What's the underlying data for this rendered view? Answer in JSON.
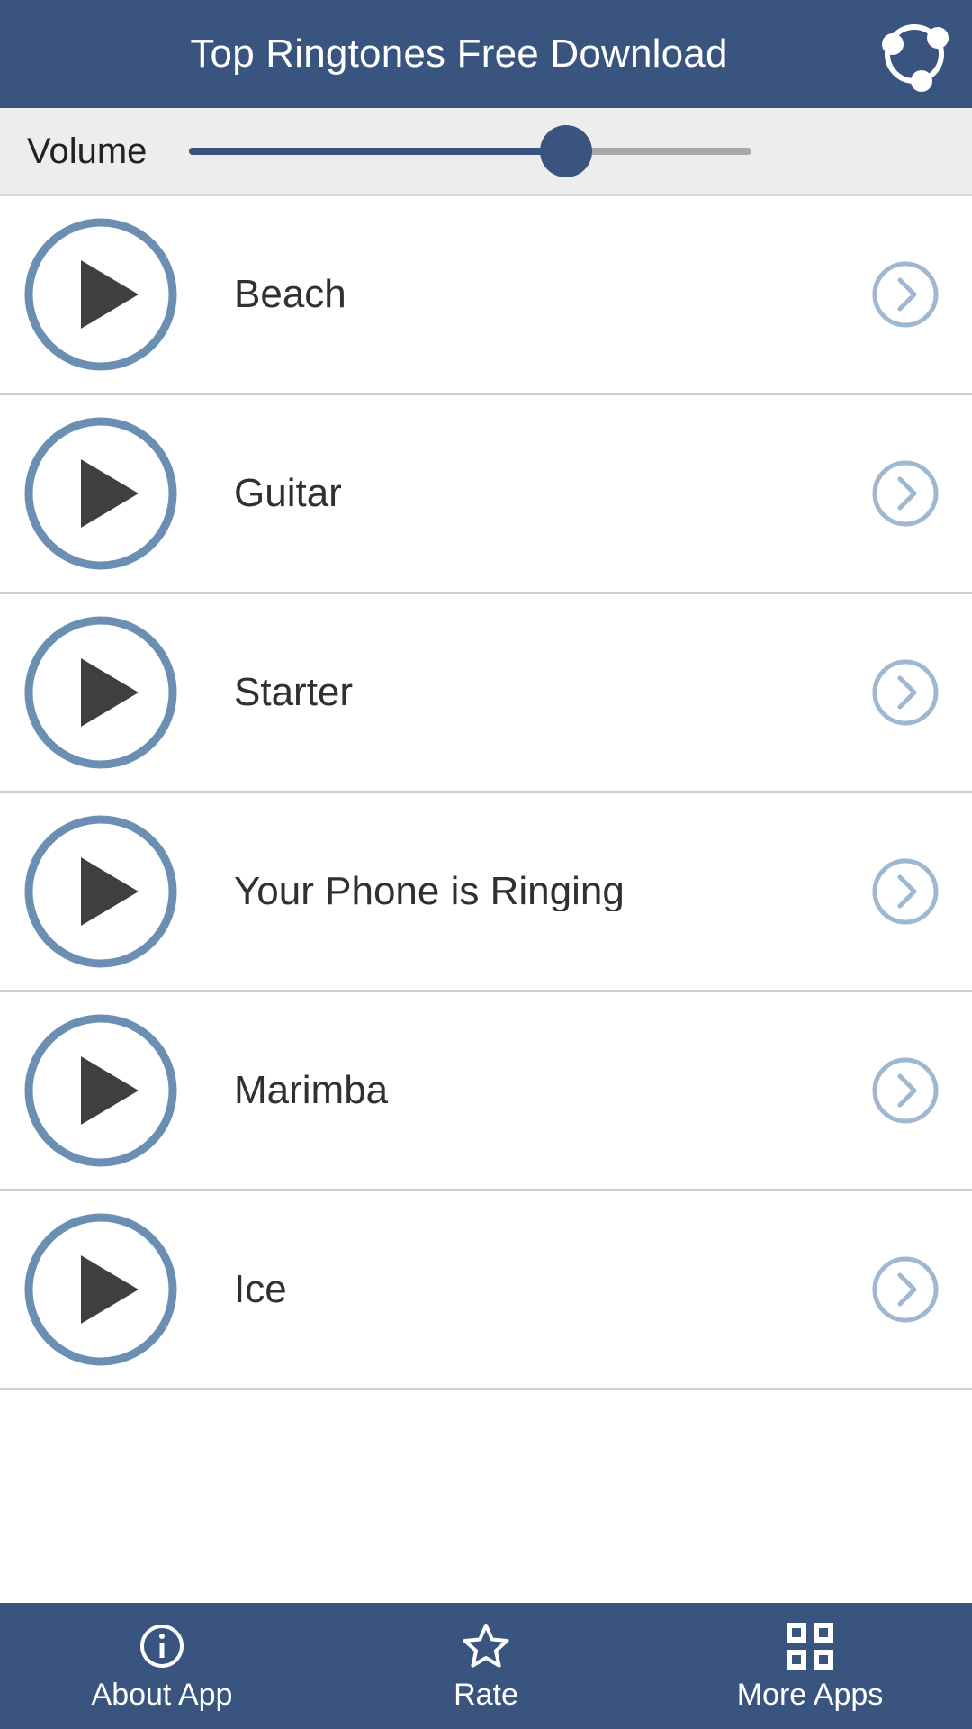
{
  "header": {
    "title": "Top Ringtones Free Download",
    "action_icon": "share-network-icon",
    "background_color": "#3a5480",
    "text_color": "#ffffff"
  },
  "volume": {
    "label": "Volume",
    "value_percent": 67,
    "track_color": "#a8a8a8",
    "fill_color": "#3a5480",
    "thumb_color": "#3a5480",
    "background_color": "#ededed"
  },
  "list": {
    "play_icon": "play-icon",
    "detail_icon": "chevron-right-circle-icon",
    "ring_color": "#6b8fb3",
    "triangle_color": "#3f3f3f",
    "chevron_color": "#9fb8d0",
    "separator_color": "#c5d0da",
    "items": [
      {
        "title": "Beach"
      },
      {
        "title": "Guitar"
      },
      {
        "title": "Starter"
      },
      {
        "title": "Your Phone is Ringing"
      },
      {
        "title": "Marimba"
      },
      {
        "title": "Ice"
      }
    ]
  },
  "bottom_nav": {
    "background_color": "#3a5480",
    "items": [
      {
        "label": "About App",
        "icon": "info-circle-icon"
      },
      {
        "label": "Rate",
        "icon": "star-outline-icon"
      },
      {
        "label": "More Apps",
        "icon": "grid-apps-icon"
      }
    ]
  }
}
